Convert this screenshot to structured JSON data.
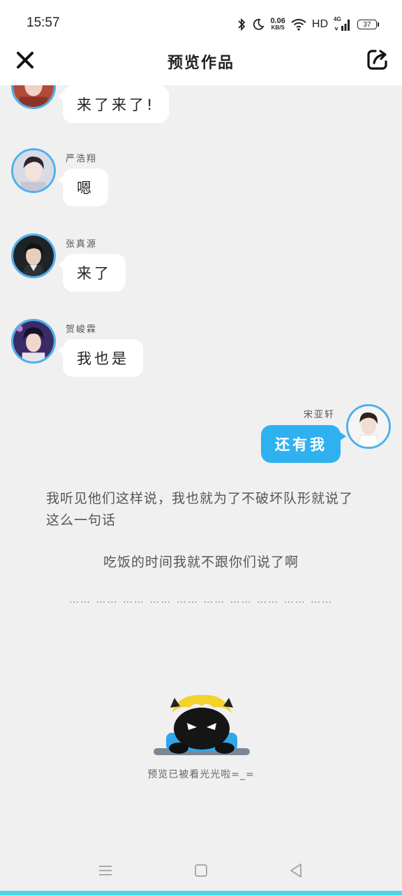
{
  "status_bar": {
    "time": "15:57",
    "net_speed_value": "0.06",
    "net_speed_unit": "KB/S",
    "hd_label": "HD",
    "network_label": "4G",
    "battery_level": "37",
    "icons": [
      "bluetooth-icon",
      "moon-icon",
      "wifi-icon",
      "signal-icon",
      "battery-icon"
    ]
  },
  "top_bar": {
    "title": "预览作品",
    "close_icon": "close-icon",
    "share_icon": "share-icon"
  },
  "messages": [
    {
      "side": "left",
      "sender": "",
      "text": "来了来了!"
    },
    {
      "side": "left",
      "sender": "严浩翔",
      "text": "嗯"
    },
    {
      "side": "left",
      "sender": "张真源",
      "text": "来了"
    },
    {
      "side": "left",
      "sender": "贺峻霖",
      "text": "我也是"
    },
    {
      "side": "right",
      "sender": "宋亚轩",
      "text": "还有我"
    }
  ],
  "narration": [
    "我听见他们这样说，我也就为了不破坏队形就说了这么一句话",
    "吃饭的时间我就不跟你们说了啊"
  ],
  "ellipsis": "…… …… …… …… …… …… …… …… …… ……",
  "end_text": "预览已被看光光啦=_=",
  "nav_bar": {
    "icons": [
      "menu-icon",
      "home-icon",
      "back-icon"
    ]
  },
  "colors": {
    "accent": "#2fb1f0",
    "avatar_border": "#4fb0ec",
    "background": "#f0f0f0",
    "bottom_strip": "#4cd6e6"
  }
}
